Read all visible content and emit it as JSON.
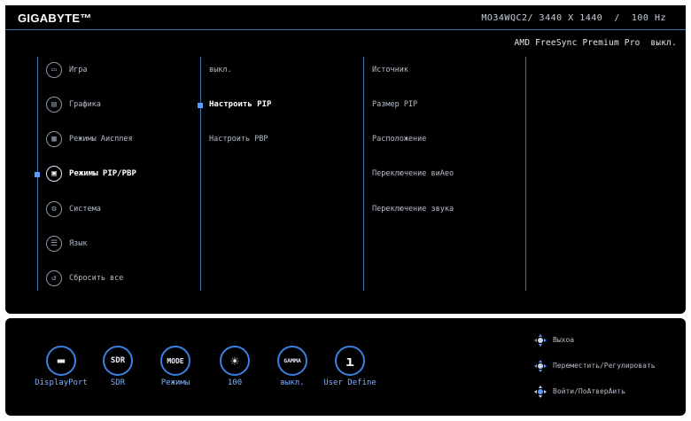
{
  "header": {
    "brand": "GIGABYTE™",
    "model_info": "MO34WQC2/ 3440 X 1440  /  100 Hz",
    "amd_status": "AMD FreeSync Premium Pro  выкл."
  },
  "menu": {
    "items": [
      {
        "label": "Игра",
        "icon": "gamepad-icon",
        "glyph": "▭"
      },
      {
        "label": "Графика",
        "icon": "picture-icon",
        "glyph": "▤"
      },
      {
        "label": "Режимы Аисплея",
        "icon": "display-mode-icon",
        "glyph": "▦"
      },
      {
        "label": "Режимы PIP/PBP",
        "icon": "pip-icon",
        "glyph": "▣",
        "selected": true
      },
      {
        "label": "Система",
        "icon": "system-gear-icon",
        "glyph": "⚙"
      },
      {
        "label": "Язык",
        "icon": "language-icon",
        "glyph": "☰"
      },
      {
        "label": "Сбросить все",
        "icon": "reset-icon",
        "glyph": "↺"
      }
    ]
  },
  "submenu": {
    "items": [
      {
        "label": "выкл."
      },
      {
        "label": "Настроить PIP",
        "selected": true
      },
      {
        "label": "Настроить PBP"
      }
    ]
  },
  "options": {
    "items": [
      {
        "label": "Источник"
      },
      {
        "label": "Размер PIP"
      },
      {
        "label": "Расположение"
      },
      {
        "label": "Переключение виАео"
      },
      {
        "label": "Переключение звука"
      }
    ]
  },
  "quick_bar": {
    "items": [
      {
        "label": "DisplayPort",
        "icon": "input-port-icon",
        "glyph": "▬"
      },
      {
        "label": "SDR",
        "icon": "sdr-icon",
        "glyph": "SDR"
      },
      {
        "label": "Режимы",
        "icon": "mode-icon",
        "glyph": "MODE"
      },
      {
        "label": "100",
        "icon": "brightness-icon",
        "glyph": "☀"
      },
      {
        "label": "выкл.",
        "icon": "gamma-icon",
        "glyph": "GAMMA"
      },
      {
        "label": "User Define",
        "icon": "temperature-icon",
        "glyph": "ı"
      }
    ]
  },
  "hints": {
    "exit": "Выхоа",
    "move": "Переместить/Регулировать",
    "enter": "Войти/ПоАтверАить"
  },
  "colors": {
    "accent": "#3c7fe0",
    "marker": "#5b9bff",
    "background": "#000000"
  }
}
